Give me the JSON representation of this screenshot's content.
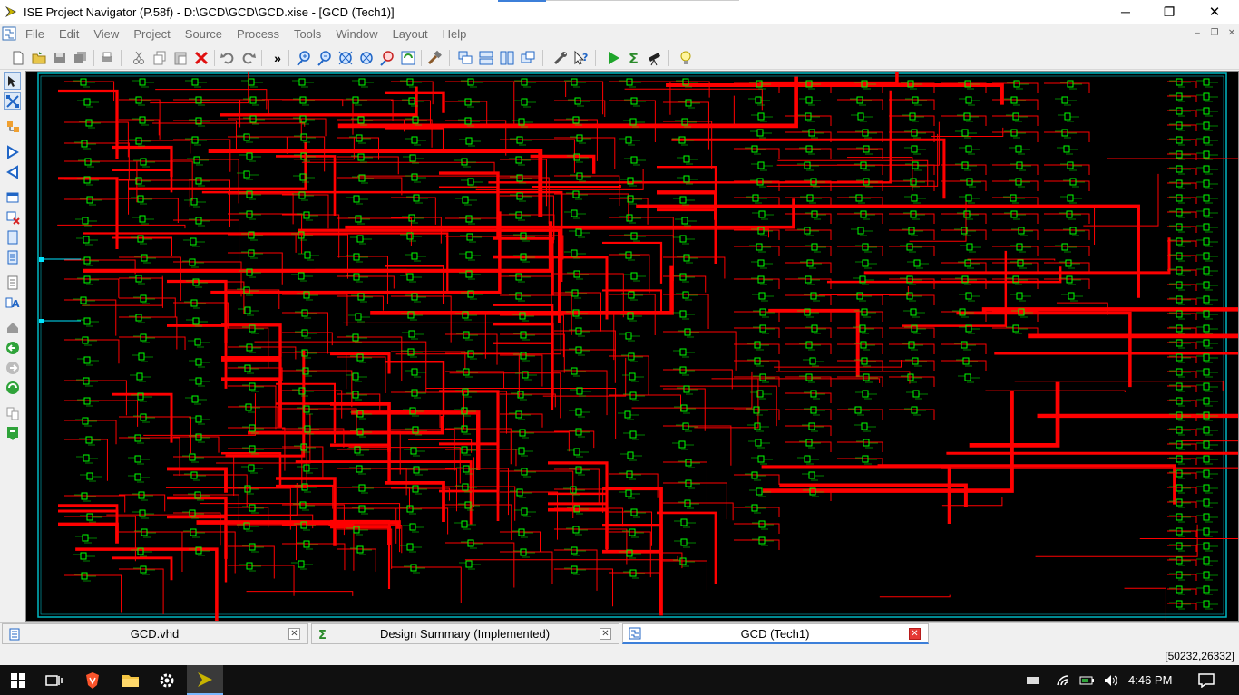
{
  "window": {
    "title": "ISE Project Navigator (P.58f) - D:\\GCD\\GCD\\GCD.xise - [GCD (Tech1)]",
    "minimize_glyph": "─",
    "maximize_glyph": "❐",
    "close_glyph": "✕"
  },
  "menu": [
    "File",
    "Edit",
    "View",
    "Project",
    "Source",
    "Process",
    "Tools",
    "Window",
    "Layout",
    "Help"
  ],
  "mdi_controls": [
    "–",
    "❐",
    "✕"
  ],
  "toolbar": {
    "overflow_label": "»",
    "icons": [
      "new-icon",
      "open-icon",
      "save-icon",
      "save-all-icon",
      "print-icon",
      "cut-icon",
      "copy-icon",
      "paste-icon",
      "delete-icon",
      "undo-icon",
      "redo-icon",
      "zoom-in-icon",
      "zoom-out-icon",
      "zoom-full-icon",
      "zoom-fit-icon",
      "zoom-selection-icon",
      "refresh-icon",
      "hammer-icon",
      "cascade-icon",
      "tile-horizontal-icon",
      "tile-vertical-icon",
      "restore-windows-icon",
      "wrench-icon",
      "help-what-icon",
      "run-icon",
      "sigma-icon",
      "telescope-icon",
      "lightbulb-icon"
    ]
  },
  "left_toolbar": {
    "icons": [
      "select-arrow-icon",
      "route-icon",
      "expand-icon",
      "forward-icon",
      "backward-icon",
      "add-pin-icon",
      "remove-pin-icon",
      "page-icon",
      "page2-icon",
      "list-icon",
      "text-format-icon",
      "home-icon",
      "back-icon",
      "next-icon",
      "refresh-view-icon",
      "copy-view-icon",
      "export-icon"
    ]
  },
  "colors": {
    "canvas_bg": "#000000",
    "wire": "#ff0000",
    "cell": "#00ff00",
    "border": "#00b7c3",
    "port": "#00e5ff"
  },
  "tabs": [
    {
      "label": "GCD.vhd",
      "icon": "document-icon",
      "active": false
    },
    {
      "label": "Design Summary (Implemented)",
      "icon": "sigma-icon",
      "active": false
    },
    {
      "label": "GCD (Tech1)",
      "icon": "schematic-icon",
      "active": true
    }
  ],
  "tab_close_glyph": "✕",
  "status": {
    "coordinates": "[50232,26332]"
  },
  "taskbar": {
    "apps": [
      "start-icon",
      "task-view-icon",
      "brave-icon",
      "file-explorer-icon",
      "settings-icon",
      "xilinx-ise-icon"
    ],
    "time": "4:46 PM",
    "tray": [
      "desktop-icon",
      "wifi-icon",
      "battery-icon",
      "volume-icon",
      "notification-icon"
    ]
  }
}
